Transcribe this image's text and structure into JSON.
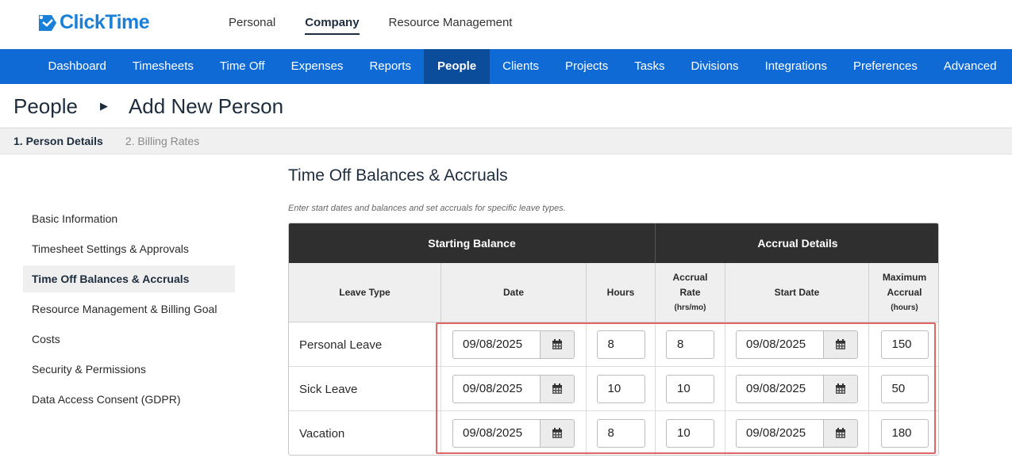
{
  "app": {
    "brand": "ClickTime",
    "brand_color": "#1a7fd6"
  },
  "top_nav": [
    "Personal",
    "Company",
    "Resource Management"
  ],
  "top_nav_active": "Company",
  "main_nav": [
    "Dashboard",
    "Timesheets",
    "Time Off",
    "Expenses",
    "Reports",
    "People",
    "Clients",
    "Projects",
    "Tasks",
    "Divisions",
    "Integrations",
    "Preferences",
    "Advanced"
  ],
  "main_nav_active": "People",
  "breadcrumb": {
    "parent": "People",
    "current": "Add New Person"
  },
  "steps": [
    {
      "label": "1. Person Details",
      "active": true
    },
    {
      "label": "2. Billing Rates",
      "active": false
    }
  ],
  "sidebar": [
    {
      "label": "Basic Information"
    },
    {
      "label": "Timesheet Settings & Approvals"
    },
    {
      "label": "Time Off Balances & Accruals",
      "active": true
    },
    {
      "label": "Resource Management & Billing Goal"
    },
    {
      "label": "Costs"
    },
    {
      "label": "Security & Permissions"
    },
    {
      "label": "Data Access Consent (GDPR)"
    }
  ],
  "section": {
    "title": "Time Off Balances & Accruals",
    "help": "Enter start dates and balances and set accruals for specific leave types."
  },
  "table": {
    "group_headers": {
      "starting": "Starting Balance",
      "accrual": "Accrual Details"
    },
    "columns": {
      "leave_type": "Leave Type",
      "date": "Date",
      "hours": "Hours",
      "rate_line1": "Accrual",
      "rate_line2": "Rate",
      "rate_unit": "(hrs/mo)",
      "start_date": "Start Date",
      "max_line1": "Maximum",
      "max_line2": "Accrual",
      "max_unit": "(hours)"
    },
    "rows": [
      {
        "leave_type": "Personal Leave",
        "date": "09/08/2025",
        "hours": "8",
        "accrual_rate": "8",
        "start_date": "09/08/2025",
        "max_accrual": "150"
      },
      {
        "leave_type": "Sick Leave",
        "date": "09/08/2025",
        "hours": "10",
        "accrual_rate": "10",
        "start_date": "09/08/2025",
        "max_accrual": "50"
      },
      {
        "leave_type": "Vacation",
        "date": "09/08/2025",
        "hours": "8",
        "accrual_rate": "10",
        "start_date": "09/08/2025",
        "max_accrual": "180"
      }
    ]
  },
  "icons": {
    "calendar": "calendar-icon",
    "breadcrumb_arrow": "caret-right-icon"
  },
  "colors": {
    "nav_blue": "#0f6ad6",
    "nav_active": "#0b4d9a",
    "header_dark": "#2f2f2f",
    "highlight": "#e06666"
  }
}
